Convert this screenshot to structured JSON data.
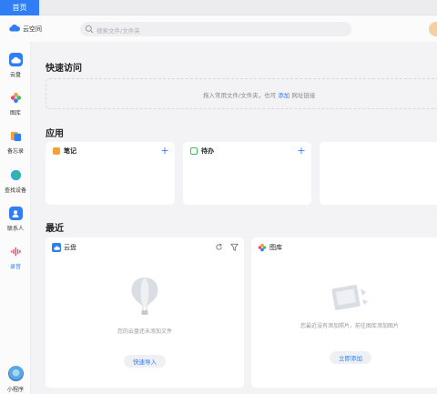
{
  "tab": {
    "home_label": "首页"
  },
  "header": {
    "app_name": "云空间",
    "search_placeholder": "搜索文件/文件夹"
  },
  "sidebar": {
    "items": [
      {
        "label": "云盘",
        "icon": "cloud-drive-icon",
        "color": "#2f7ef5"
      },
      {
        "label": "图库",
        "icon": "gallery-icon",
        "color": "#f39a3c"
      },
      {
        "label": "备忘录",
        "icon": "memo-icon",
        "color": "#f3a13a"
      },
      {
        "label": "查找设备",
        "icon": "find-device-icon",
        "color": "#2fa9e6"
      },
      {
        "label": "联系人",
        "icon": "contacts-icon",
        "color": "#2f7ef5"
      },
      {
        "label": "录音",
        "icon": "recorder-icon",
        "color": "#e94b6a"
      }
    ],
    "active_index": 5,
    "mini_program_label": "小程序"
  },
  "quick_access": {
    "title": "快速访问",
    "hint_before": "拖入常用文件/文件夹，也可",
    "hint_link": "添加",
    "hint_after": "网址链接"
  },
  "apps": {
    "title": "应用",
    "cards": [
      {
        "title": "笔记",
        "icon": "note-icon",
        "color": "#f3a13a"
      },
      {
        "title": "待办",
        "icon": "todo-icon",
        "color": "#3cc15a"
      }
    ]
  },
  "recent": {
    "title": "最近",
    "cloud": {
      "title": "云盘",
      "empty_text": "您的云盘还未添加文件",
      "button": "快速导入"
    },
    "gallery": {
      "title": "图库",
      "empty_text": "您最近没有添加照片，前往图库添加图片",
      "button": "立即添加"
    }
  },
  "colors": {
    "accent": "#2f7ef5",
    "background": "#f3f3f6"
  }
}
